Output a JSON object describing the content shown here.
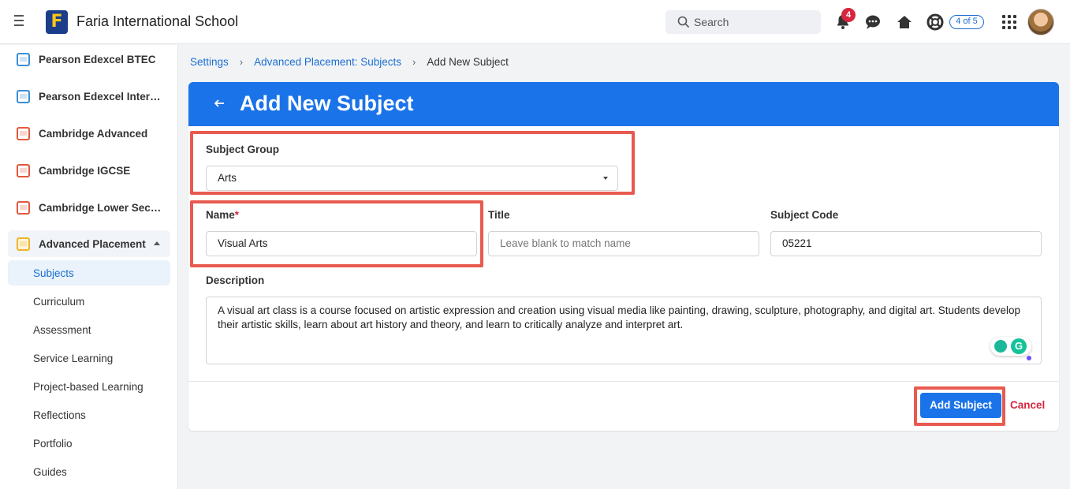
{
  "app": {
    "school_name": "Faria International School",
    "logo_letter": "F"
  },
  "header": {
    "search_placeholder": "Search",
    "notification_count": "4",
    "progress_label": "4 of 5"
  },
  "sidebar": {
    "programs": [
      {
        "label": "Pearson Edexcel BTEC",
        "icon": "edexcel-btec-icon"
      },
      {
        "label": "Pearson Edexcel Inter…",
        "icon": "edexcel-international-icon"
      },
      {
        "label": "Cambridge Advanced",
        "icon": "cambridge-advanced-icon"
      },
      {
        "label": "Cambridge IGCSE",
        "icon": "cambridge-igcse-icon"
      },
      {
        "label": "Cambridge Lower Sec…",
        "icon": "cambridge-lower-secondary-icon"
      },
      {
        "label": "Advanced Placement",
        "icon": "advanced-placement-icon"
      }
    ],
    "ap_children": [
      "Subjects",
      "Curriculum",
      "Assessment",
      "Service Learning",
      "Project-based Learning",
      "Reflections",
      "Portfolio",
      "Guides"
    ]
  },
  "breadcrumb": {
    "items": [
      "Settings",
      "Advanced Placement: Subjects"
    ],
    "current": "Add New Subject"
  },
  "form": {
    "title": "Add New Subject",
    "subject_group_label": "Subject Group",
    "subject_group_value": "Arts",
    "name_label": "Name",
    "required_mark": "*",
    "name_value": "Visual Arts",
    "title_label": "Title",
    "title_placeholder": "Leave blank to match name",
    "code_label": "Subject Code",
    "code_value": "05221",
    "description_label": "Description",
    "description_value": "A visual art class is a course focused on artistic expression and creation using visual media like painting, drawing, sculpture, photography, and digital art. Students develop their artistic skills, learn about art history and theory, and learn to critically analyze and interpret art.",
    "submit_label": "Add Subject",
    "cancel_label": "Cancel"
  },
  "colors": {
    "brand_blue": "#1a73e8",
    "link_blue": "#1a6fd1",
    "danger_red": "#d7263d",
    "highlight_red": "#e85a4f"
  }
}
